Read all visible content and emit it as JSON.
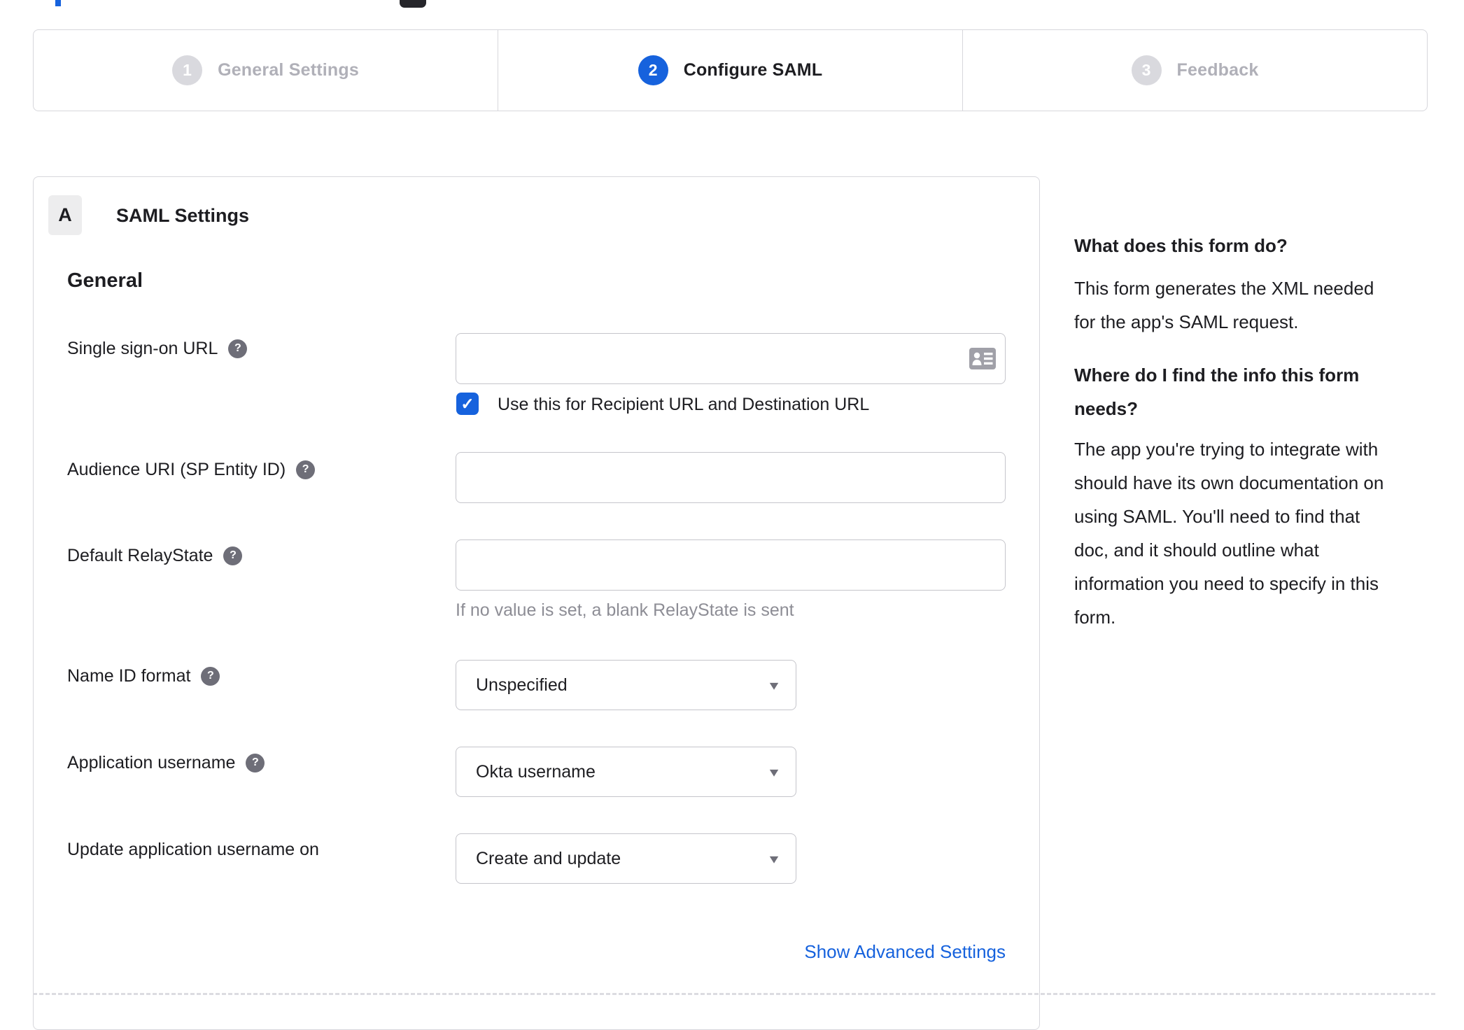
{
  "colors": {
    "accent_blue": "#1662dd",
    "text_dark": "#1d1d21",
    "inactive_gray": "#b0b0b8",
    "border_gray": "#d7d7dc"
  },
  "icons": {
    "help_glyph": "?",
    "dropdown_arrow": "▾",
    "checkmark": "✓"
  },
  "stepper": {
    "steps": [
      {
        "number": "1",
        "label": "General Settings",
        "state": "inactive"
      },
      {
        "number": "2",
        "label": "Configure SAML",
        "state": "active"
      },
      {
        "number": "3",
        "label": "Feedback",
        "state": "inactive"
      }
    ]
  },
  "form": {
    "section_badge": "A",
    "section_title": "SAML Settings",
    "group_heading": "General",
    "sso": {
      "label": "Single sign-on URL",
      "value": "",
      "checkbox_checked": true,
      "checkbox_label": "Use this for Recipient URL and Destination URL"
    },
    "audience": {
      "label": "Audience URI (SP Entity ID)",
      "value": ""
    },
    "relay_state": {
      "label": "Default RelayState",
      "value": "",
      "hint": "If no value is set, a blank RelayState is sent"
    },
    "name_id_format": {
      "label": "Name ID format",
      "value": "Unspecified"
    },
    "application_username": {
      "label": "Application username",
      "value": "Okta username"
    },
    "update_app_username": {
      "label": "Update application username on",
      "value": "Create and update"
    },
    "advanced_link": "Show Advanced Settings"
  },
  "sidebar": {
    "q1_title": "What does this form do?",
    "q1_body": "This form generates the XML needed\nfor the app's SAML request.",
    "q2_title": "Where do I find the info this form\nneeds?",
    "q2_body": "The app you're trying to integrate with\nshould have its own documentation on\nusing SAML. You'll need to find that\ndoc, and it should outline what\ninformation you need to specify in this\nform."
  }
}
